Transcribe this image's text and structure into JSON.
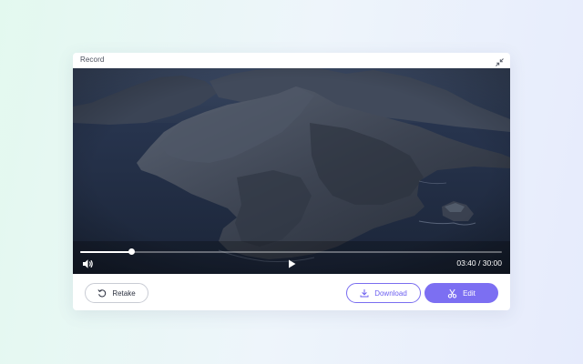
{
  "window": {
    "title": "Record",
    "collapse_icon": "collapse-arrows-icon"
  },
  "player": {
    "current_time": "03:40",
    "separator": "/",
    "duration": "30:00",
    "time_display": "03:40 / 30:00",
    "progress_fraction": 0.1222,
    "volume_icon": "speaker-icon",
    "play_icon": "play-icon"
  },
  "actions": {
    "retake_label": "Retake",
    "retake_icon": "refresh-icon",
    "download_label": "Download",
    "download_icon": "download-icon",
    "edit_label": "Edit",
    "edit_icon": "scissors-icon"
  },
  "colors": {
    "accent": "#7c6ff2",
    "accent_text": "#6b5ef0",
    "border_neutral": "#c9ccd4"
  }
}
